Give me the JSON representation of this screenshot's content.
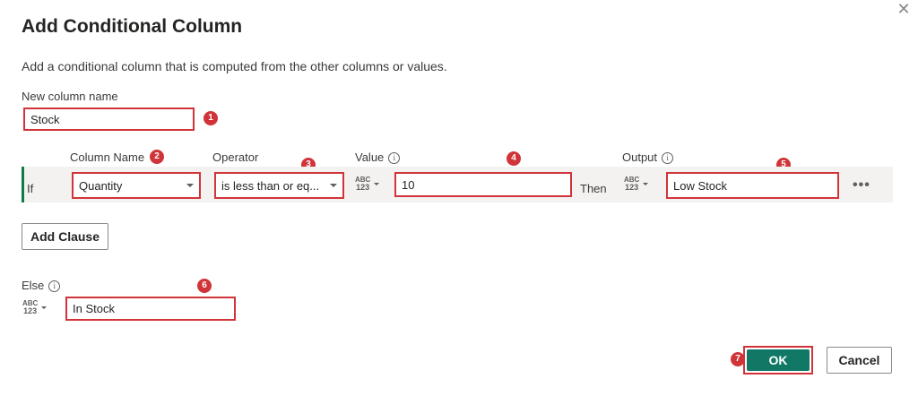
{
  "dialog": {
    "title": "Add Conditional Column",
    "description": "Add a conditional column that is computed from the other columns or values.",
    "close_icon": "close-icon"
  },
  "new_column": {
    "label": "New column name",
    "value": "Stock"
  },
  "headers": {
    "column_name": "Column Name",
    "operator": "Operator",
    "value": "Value",
    "output": "Output"
  },
  "clause": {
    "if_label": "If",
    "column_name": "Quantity",
    "operator": "is less than or eq...",
    "value_type_top": "ABC",
    "value_type_bottom": "123",
    "value": "10",
    "then_label": "Then",
    "output_type_top": "ABC",
    "output_type_bottom": "123",
    "output": "Low Stock",
    "more_icon": "ellipsis-icon"
  },
  "add_clause_label": "Add Clause",
  "else": {
    "label": "Else",
    "type_top": "ABC",
    "type_bottom": "123",
    "value": "In Stock"
  },
  "buttons": {
    "ok": "OK",
    "cancel": "Cancel"
  },
  "badges": [
    "1",
    "2",
    "3",
    "4",
    "5",
    "6",
    "7"
  ],
  "colors": {
    "highlight": "#d13438",
    "ok_button": "#117865",
    "row_accent": "#107c41"
  }
}
